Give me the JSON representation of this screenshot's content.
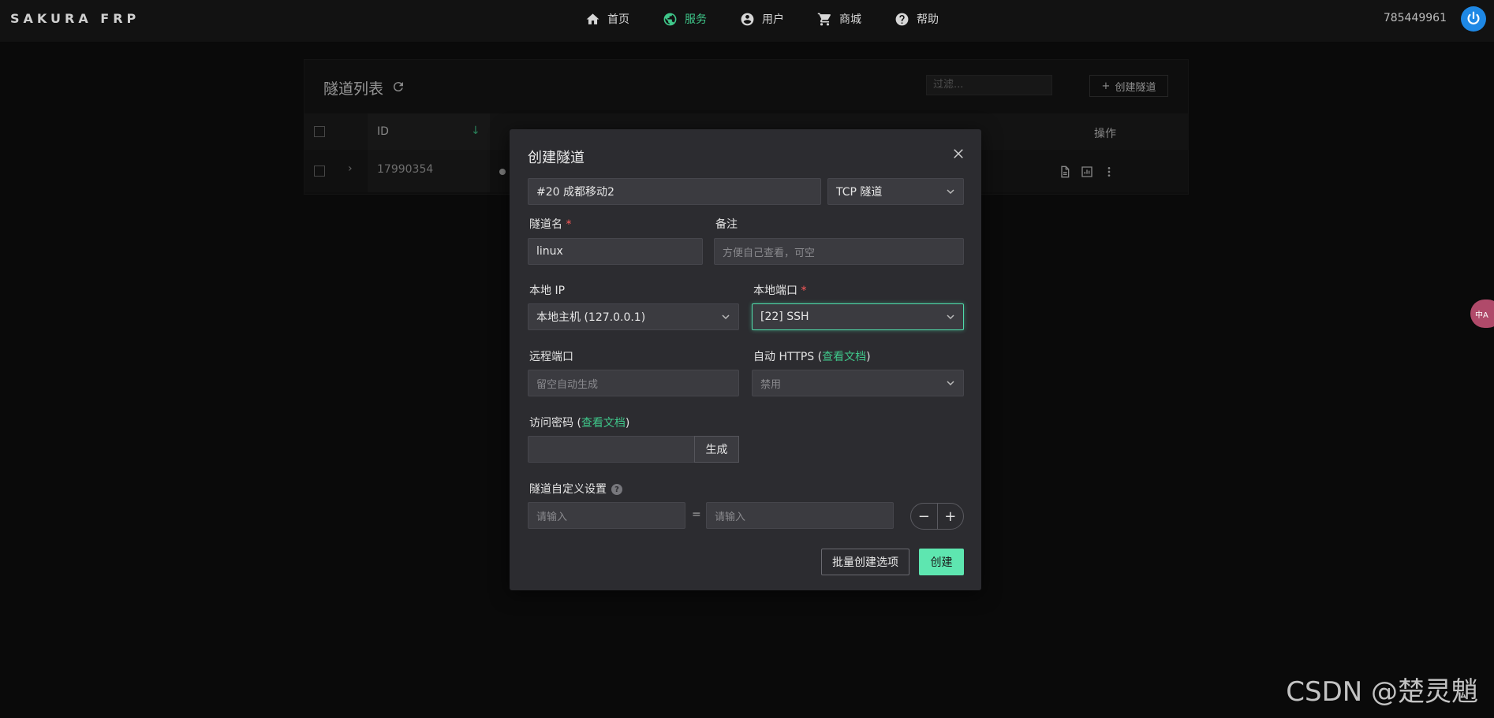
{
  "app": {
    "brand": "SAKURA FRP",
    "user_id": "785449961"
  },
  "nav": [
    {
      "label": "首页",
      "icon": "home-icon"
    },
    {
      "label": "服务",
      "icon": "globe-icon",
      "active": true
    },
    {
      "label": "用户",
      "icon": "user-icon"
    },
    {
      "label": "商城",
      "icon": "cart-icon"
    },
    {
      "label": "帮助",
      "icon": "help-icon"
    }
  ],
  "card": {
    "title": "隧道列表",
    "filter_placeholder": "过滤...",
    "create_label": "创建隧道",
    "columns": [
      "ID",
      "操作"
    ],
    "rows": [
      {
        "id": "17990354"
      }
    ]
  },
  "modal": {
    "title": "创建隧道",
    "node": "#20 成都移动2",
    "type": "TCP 隧道",
    "name_label": "隧道名",
    "name_value": "linux",
    "note_label": "备注",
    "note_placeholder": "方便自己查看，可空",
    "local_ip_label": "本地 IP",
    "local_ip_value": "本地主机 (127.0.0.1)",
    "local_port_label": "本地端口",
    "local_port_value": "[22] SSH",
    "remote_port_label": "远程端口",
    "remote_port_placeholder": "留空自动生成",
    "https_label": "自动 HTTPS (",
    "https_link": "查看文档",
    "https_close": ")",
    "https_value": "禁用",
    "password_label": "访问密码 (",
    "password_link": "查看文档",
    "password_close": ")",
    "generate_label": "生成",
    "custom_label": "隧道自定义设置",
    "key_placeholder": "请输入",
    "equals": "=",
    "value_placeholder": "请输入",
    "minus": "−",
    "plus": "+",
    "batch_label": "批量创建选项",
    "submit_label": "创建",
    "required_mark": "*"
  },
  "side_bubble": "中A",
  "watermark": "CSDN @楚灵魈"
}
